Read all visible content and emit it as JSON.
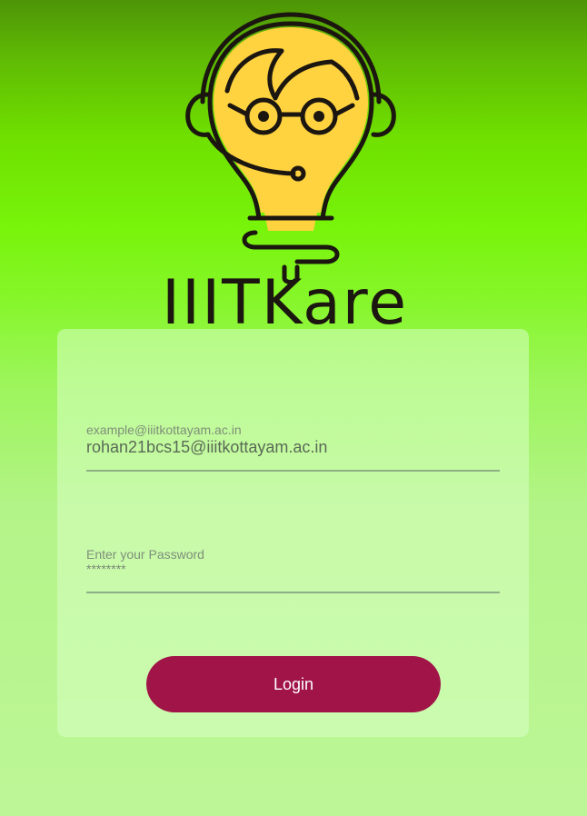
{
  "brand": {
    "name": "IIITKare",
    "logo_icon": "lightbulb-face-headset-icon"
  },
  "login": {
    "email": {
      "placeholder": "example@iiitkottayam.ac.in",
      "value": "rohan21bcs15@iiitkottayam.ac.in"
    },
    "password": {
      "placeholder": "Enter your Password",
      "value": "********"
    },
    "button_label": "Login"
  },
  "colors": {
    "button": "#a01448",
    "gradient_top": "#4d9407",
    "gradient_mid": "#78f40a",
    "gradient_bottom": "#bdf697",
    "bulb_fill": "#ffd23f",
    "outline": "#1b160f"
  }
}
